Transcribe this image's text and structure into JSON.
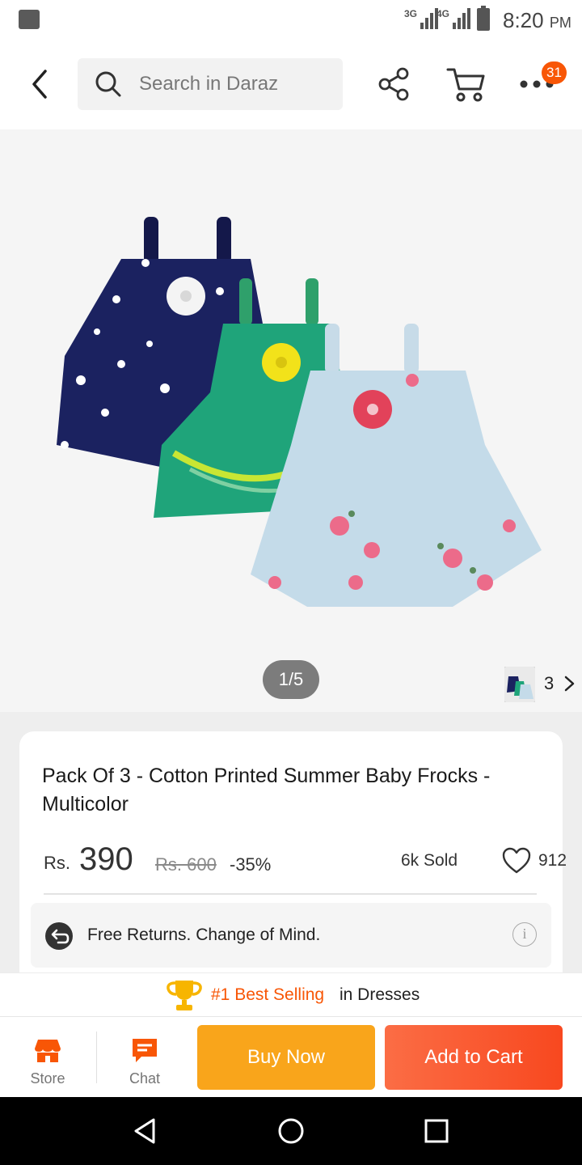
{
  "status_bar": {
    "network_3g": "3G",
    "network_4g": "4G",
    "time": "8:20",
    "time_suffix": "PM"
  },
  "header": {
    "search_placeholder": "Search in Daraz",
    "more_badge": "31"
  },
  "gallery": {
    "page_indicator": "1/5",
    "variant_count": "3"
  },
  "product": {
    "title": "Pack Of 3 - Cotton Printed Summer Baby Frocks - Multicolor",
    "currency": "Rs.",
    "price": "390",
    "original_price": "Rs. 600",
    "discount": "-35%",
    "sold": "6k Sold",
    "wishlist_count": "912",
    "returns_text": "Free Returns. Change of Mind.",
    "info_icon": "i"
  },
  "best_selling": {
    "label": "#1 Best Selling",
    "category": "in Dresses"
  },
  "action_bar": {
    "store_label": "Store",
    "chat_label": "Chat",
    "buy_now_label": "Buy Now",
    "add_to_cart_label": "Add to Cart"
  },
  "colors": {
    "brand_orange": "#f85606",
    "buy_now": "#f9a51b",
    "add_to_cart": "#f8481f"
  }
}
